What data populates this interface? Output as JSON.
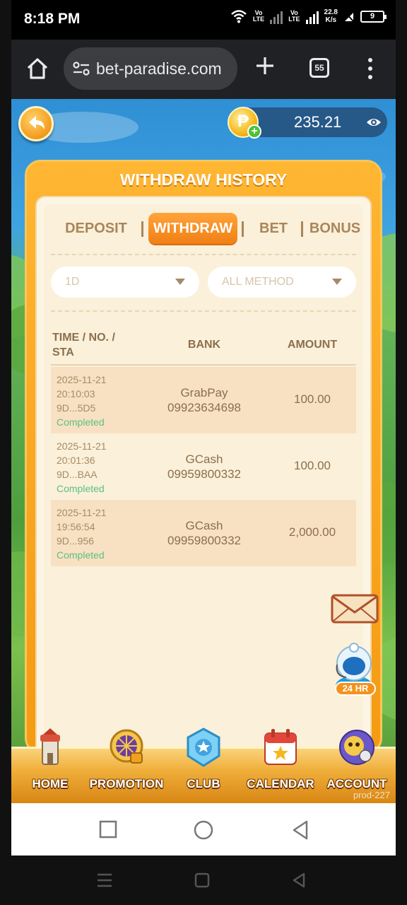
{
  "status_bar": {
    "time": "8:18 PM",
    "net_speed_top": "22.8",
    "net_speed_bottom": "K/s",
    "lte1": "Vo\nLTE",
    "lte2": "Vo\nLTE",
    "battery": "9"
  },
  "browser": {
    "url": "bet-paradise.com",
    "tab_count": "55"
  },
  "header": {
    "balance": "235.21"
  },
  "panel": {
    "title": "WITHDRAW HISTORY",
    "tabs": [
      {
        "label": "DEPOSIT",
        "active": false
      },
      {
        "label": "WITHDRAW",
        "active": true
      },
      {
        "label": "BET",
        "active": false
      },
      {
        "label": "BONUS",
        "active": false
      }
    ],
    "filters": {
      "period": "1D",
      "method": "ALL METHOD"
    },
    "columns": {
      "time": "TIME / NO. / STA",
      "bank": "BANK",
      "amount": "AMOUNT"
    },
    "rows": [
      {
        "date": "2025-11-21",
        "time": "20:10:03",
        "no": "9D...5D5",
        "status": "Completed",
        "bank": "GrabPay",
        "account": "09923634698",
        "amount": "100.00"
      },
      {
        "date": "2025-11-21",
        "time": "20:01:36",
        "no": "9D...BAA",
        "status": "Completed",
        "bank": "GCash",
        "account": "09959800332",
        "amount": "100.00"
      },
      {
        "date": "2025-11-21",
        "time": "19:56:54",
        "no": "9D...956",
        "status": "Completed",
        "bank": "GCash",
        "account": "09959800332",
        "amount": "2,000.00"
      }
    ]
  },
  "floating": {
    "support_label": "24 HR"
  },
  "game_nav": {
    "items": [
      {
        "label": "HOME"
      },
      {
        "label": "PROMOTION"
      },
      {
        "label": "CLUB"
      },
      {
        "label": "CALENDAR"
      },
      {
        "label": "ACCOUNT"
      }
    ],
    "build_tag": "prod-227"
  },
  "colors": {
    "accent_orange": "#f59a13",
    "completed_green": "#5bc081",
    "panel_bg": "#fbf0d9"
  }
}
